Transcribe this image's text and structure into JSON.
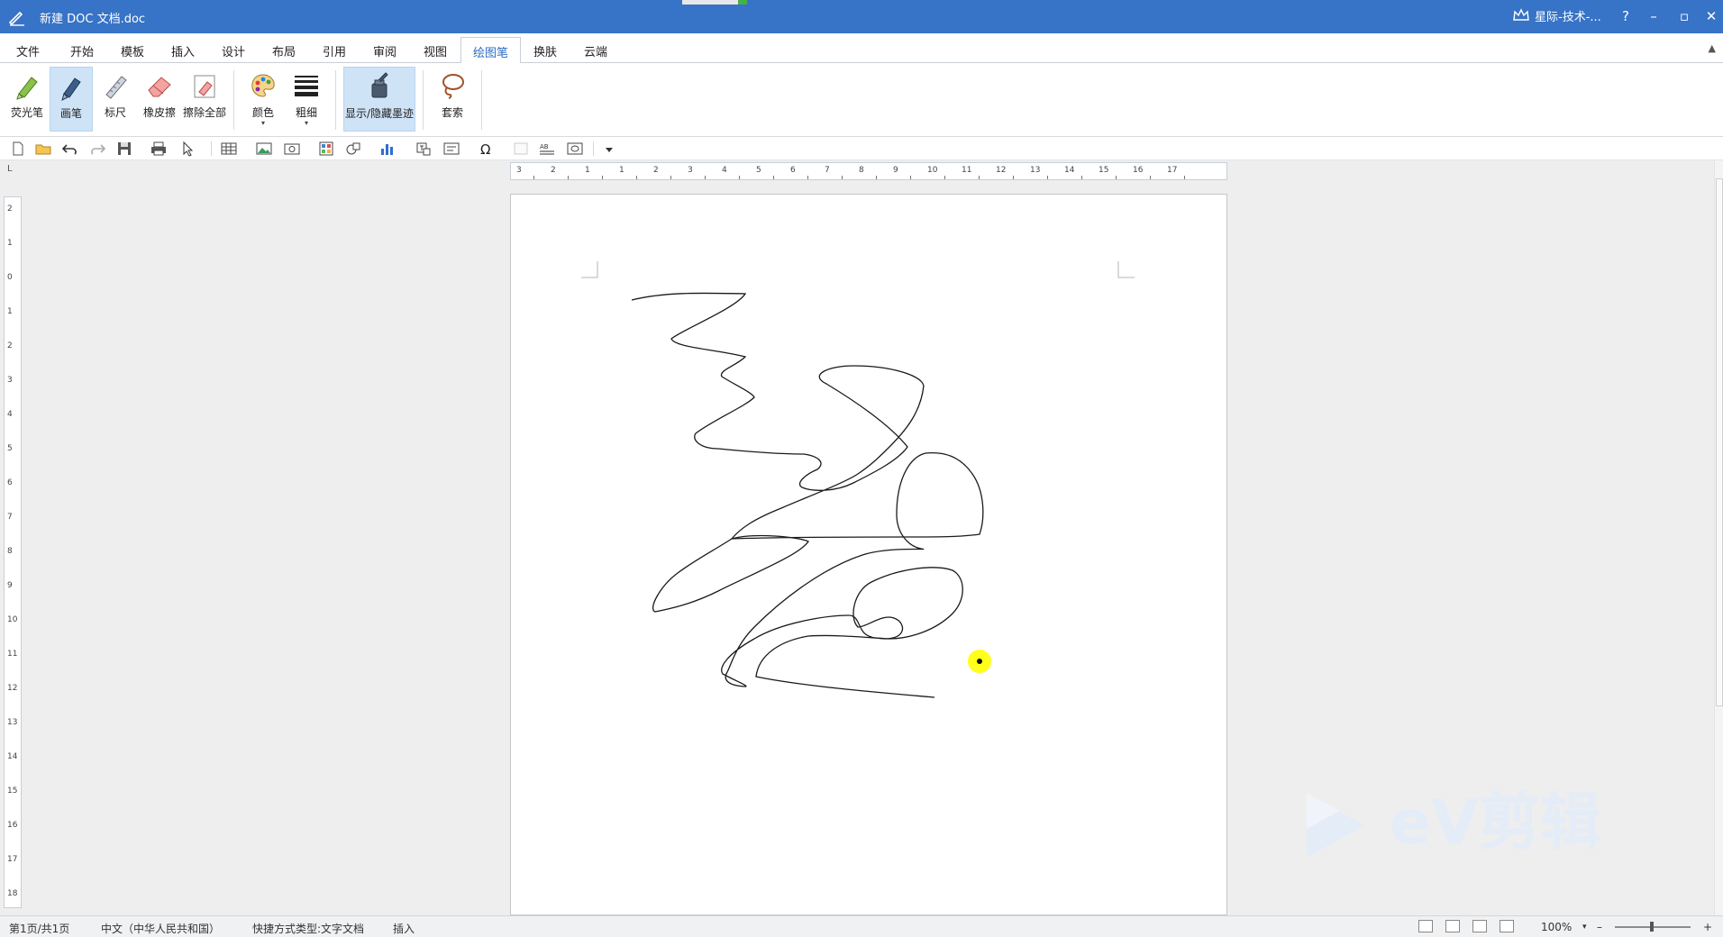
{
  "window": {
    "title": "新建 DOC 文档.doc",
    "user": "星际-技术-...",
    "help_label": "?",
    "minimize_label": "–",
    "restore_label": "▫",
    "close_label": "✕"
  },
  "menu": {
    "items": [
      "文件",
      "开始",
      "模板",
      "插入",
      "设计",
      "布局",
      "引用",
      "审阅",
      "视图",
      "绘图笔",
      "换肤",
      "云端"
    ],
    "active": "绘图笔",
    "collapse_label": "▲"
  },
  "ribbon": {
    "highlighter": "荧光笔",
    "pen": "画笔",
    "ruler": "标尺",
    "eraser": "橡皮擦",
    "erase_all": "擦除全部",
    "color": "颜色",
    "thickness": "粗细",
    "toggle_ink": "显示/隐藏墨迹",
    "lasso": "套索",
    "dropdown_arrow": "▾"
  },
  "qat": {
    "icons": [
      "new-doc-icon",
      "open-folder-icon",
      "undo-icon",
      "redo-icon",
      "save-icon",
      "print-icon",
      "select-pointer-icon",
      "table-icon",
      "picture-icon",
      "screenshot-icon",
      "image-grid-icon",
      "shapes-icon",
      "chart-icon",
      "text-box-icon",
      "field-icon",
      "symbol-icon",
      "spellcheck-icon",
      "view-icon",
      "customize-icon"
    ]
  },
  "ruler": {
    "corner_label": "L",
    "horizontal": [
      "3",
      "2",
      "1",
      "1",
      "2",
      "3",
      "4",
      "5",
      "6",
      "7",
      "8",
      "9",
      "10",
      "11",
      "12",
      "13",
      "14",
      "15",
      "16",
      "17"
    ],
    "vertical": [
      "2",
      "1",
      "0",
      "1",
      "2",
      "3",
      "4",
      "5",
      "6",
      "7",
      "8",
      "9",
      "10",
      "11",
      "12",
      "13",
      "14",
      "15",
      "16",
      "17",
      "18"
    ]
  },
  "watermark": {
    "text": "eV剪辑"
  },
  "status": {
    "page": "第1页/共1页",
    "language": "中文（中华人民共和国）",
    "doc_type": "快捷方式类型:文字文档",
    "mode": "插入",
    "zoom": "100%",
    "zoom_out": "–",
    "zoom_in": "+"
  },
  "colors": {
    "titlebar": "#3773c6",
    "active_tab_text": "#2e6cc4",
    "selected_button": "#cfe3f7",
    "cursor_highlight": "#ffff00",
    "ink": "#1a1a1a"
  }
}
